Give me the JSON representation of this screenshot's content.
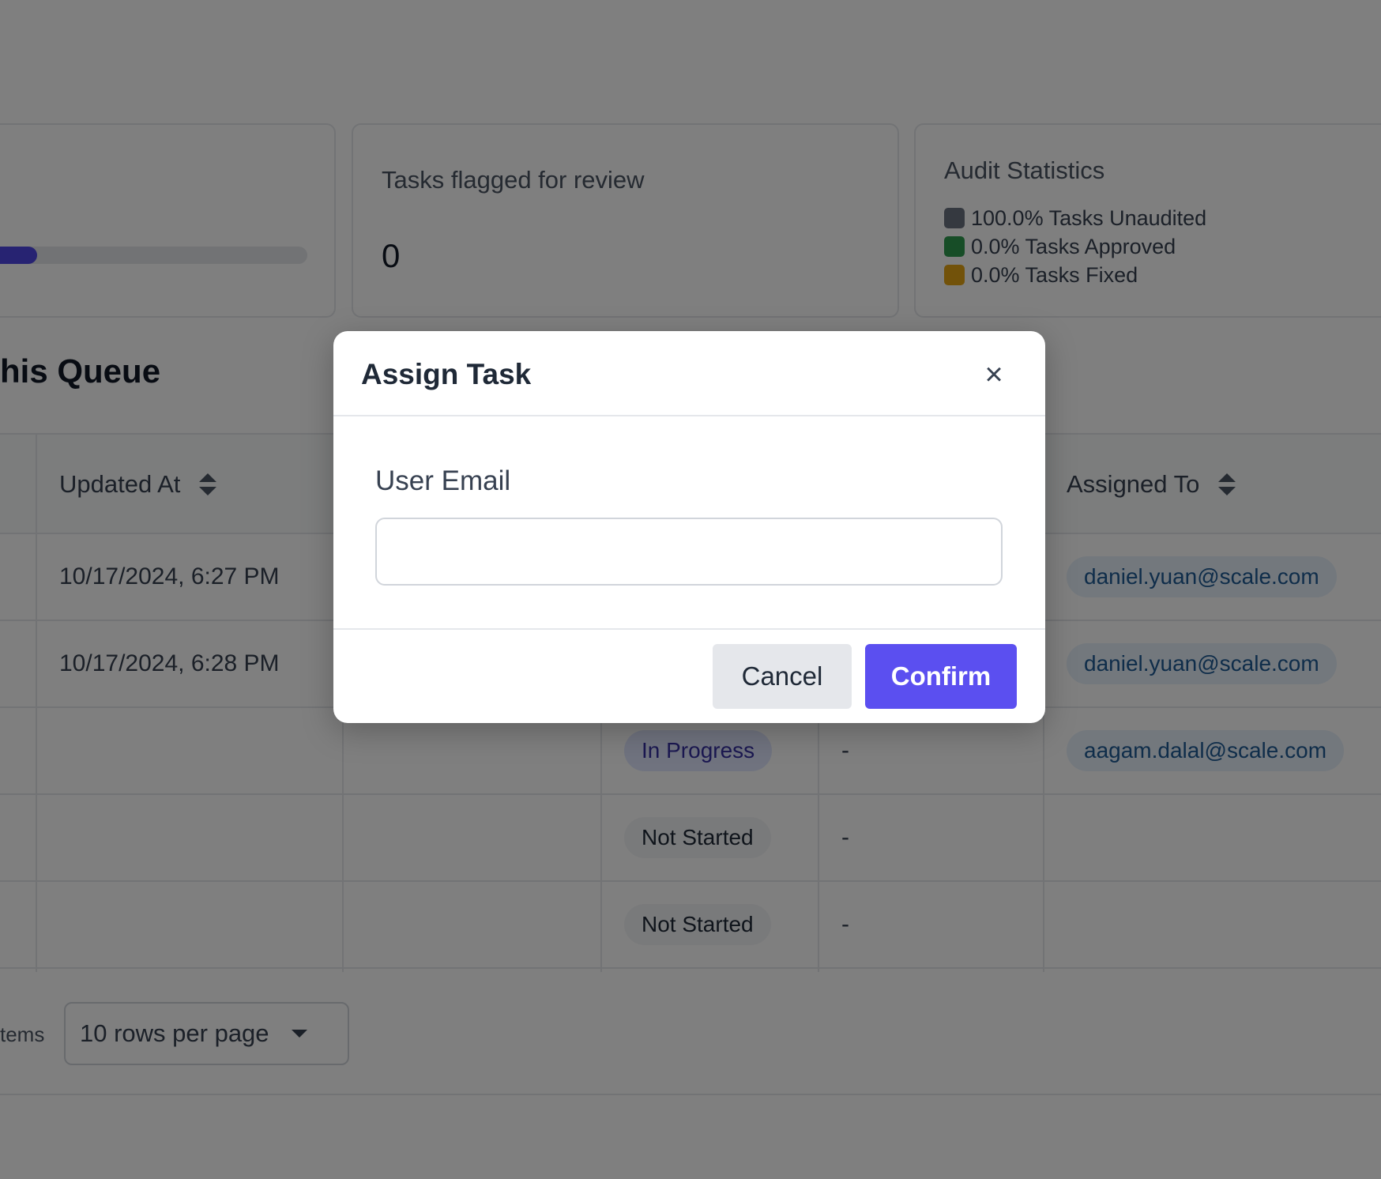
{
  "stats": {
    "progress_fraction": 0.16,
    "flagged_title": "Tasks flagged for review",
    "flagged_count": "0",
    "audit_title": "Audit Statistics",
    "audit_legend": [
      {
        "label": "100.0% Tasks Unaudited",
        "color": "#6b7280"
      },
      {
        "label": "0.0% Tasks Approved",
        "color": "#2e9a4f"
      },
      {
        "label": "0.0% Tasks Fixed",
        "color": "#e4a514"
      }
    ]
  },
  "section_title": "his Queue",
  "table": {
    "headers": {
      "updated_at": "Updated At",
      "assigned_to": "Assigned To"
    },
    "rows": [
      {
        "updated_at": "10/17/2024, 6:27 PM",
        "status": "",
        "extra": "",
        "assigned_to": "daniel.yuan@scale.com"
      },
      {
        "updated_at": "10/17/2024, 6:28 PM",
        "status": "",
        "extra": "",
        "assigned_to": "daniel.yuan@scale.com"
      },
      {
        "updated_at": "",
        "status": "In Progress",
        "extra": "-",
        "assigned_to": "aagam.dalal@scale.com"
      },
      {
        "updated_at": "",
        "status": "Not Started",
        "extra": "-",
        "assigned_to": ""
      },
      {
        "updated_at": "",
        "status": "Not Started",
        "extra": "-",
        "assigned_to": ""
      }
    ]
  },
  "footer": {
    "items_text": "tems",
    "rows_per_page": "10 rows per page"
  },
  "modal": {
    "title": "Assign Task",
    "close_symbol": "×",
    "field_label": "User Email",
    "email_value": "",
    "cancel_label": "Cancel",
    "confirm_label": "Confirm"
  }
}
